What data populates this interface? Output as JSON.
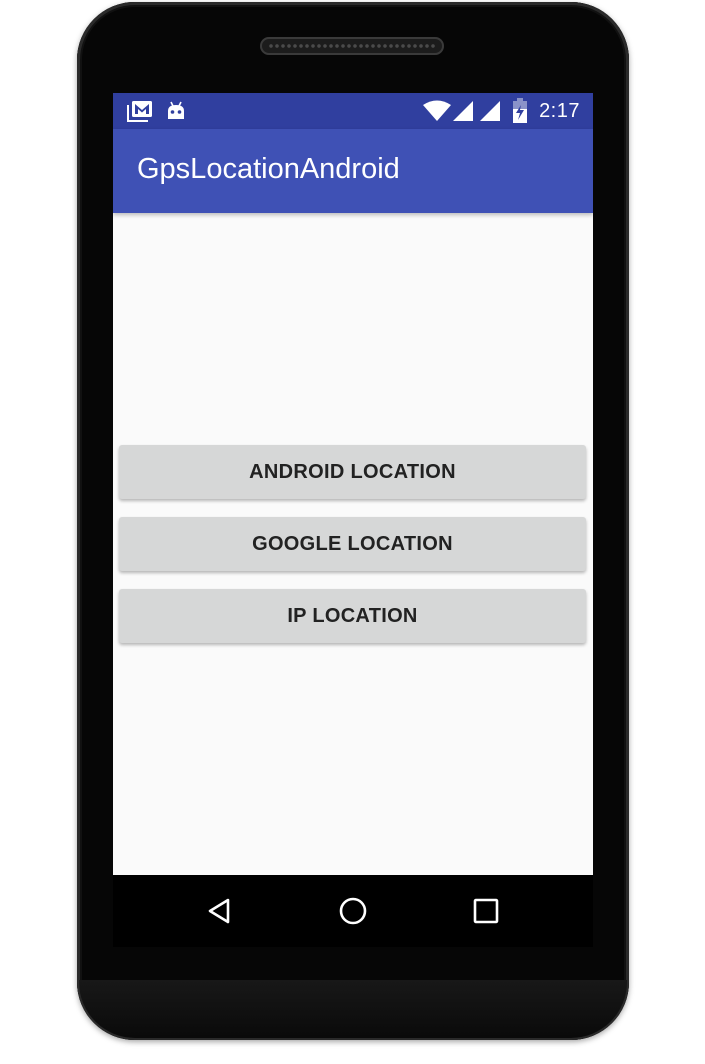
{
  "status_bar": {
    "time": "2:17",
    "left_icons": [
      "gmail-notification-icon",
      "android-notification-icon"
    ],
    "right_icons": [
      "wifi-icon",
      "cell-signal-icon",
      "cell-signal-icon",
      "battery-charging-icon"
    ]
  },
  "app_bar": {
    "title": "GpsLocationAndroid"
  },
  "buttons": [
    {
      "label": "ANDROID LOCATION"
    },
    {
      "label": "GOOGLE LOCATION"
    },
    {
      "label": "IP LOCATION"
    }
  ],
  "nav_bar": {
    "icons": [
      "back-icon",
      "home-icon",
      "recents-icon"
    ]
  },
  "colors": {
    "status_bar": "#303f9f",
    "app_bar": "#3f51b5",
    "background": "#fafafa",
    "button": "#d6d7d7"
  }
}
